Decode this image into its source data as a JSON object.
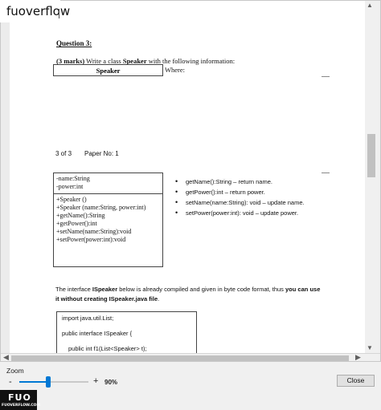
{
  "watermark": {
    "top": "fuoverflow",
    "logo": "FUO",
    "site": "FUOVERFLOW.COM"
  },
  "document": {
    "question_title": "Question 3:",
    "question_marks": "(3 marks)",
    "question_text_pre": " Write a class ",
    "question_class": "Speaker",
    "question_text_post": " with the following information:",
    "class_box": "Speaker",
    "where": "Where:",
    "page_info": {
      "page": "3 of 3",
      "paper": "Paper No: 1"
    },
    "uml": {
      "attributes": [
        "-name:String",
        "-power:int"
      ],
      "methods": [
        "+Speaker ()",
        "+Speaker (name:String, power:int)",
        "+getName():String",
        "+getPower():int",
        "+setName(name:String):void",
        "+setPower(power:int):void"
      ]
    },
    "bullets": [
      "getName():String – return name.",
      "getPower():int – return power.",
      "setName(name:String): void – update name.",
      "setPower(power:int): void – update power."
    ],
    "iface_pre": "The interface ",
    "iface_name": "ISpeaker",
    "iface_mid": " below is already compiled and given in byte code format, thus ",
    "iface_bold1": "you can use it without creating ISpeaker.java file",
    "iface_end": ".",
    "code": [
      "import java.util.List;",
      "public interface ISpeaker {",
      "public int f1(List<Speaker> t);"
    ]
  },
  "controls": {
    "zoom_label": "Zoom",
    "zoom_minus": "-",
    "zoom_plus": "+",
    "zoom_value": "90%",
    "zoom_level": 0.42,
    "close_label": "Close"
  },
  "colors": {
    "accent": "#0078d4"
  }
}
